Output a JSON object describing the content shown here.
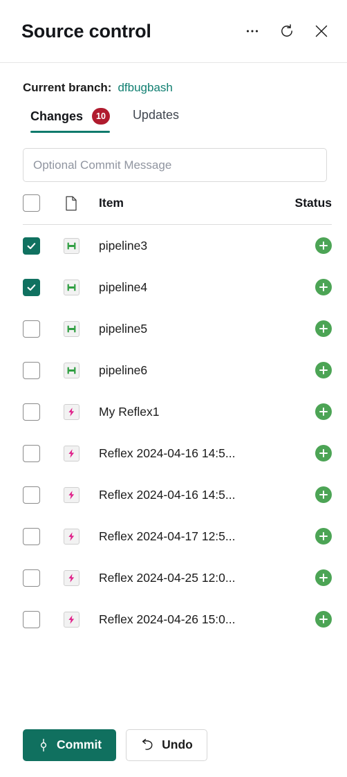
{
  "header": {
    "title": "Source control",
    "actions": [
      {
        "name": "more-options-icon",
        "label": "More options"
      },
      {
        "name": "refresh-icon",
        "label": "Refresh"
      },
      {
        "name": "close-icon",
        "label": "Close"
      }
    ]
  },
  "branch": {
    "label": "Current branch:",
    "name": "dfbugbash"
  },
  "tabs": [
    {
      "label": "Changes",
      "badge": "10",
      "active": true
    },
    {
      "label": "Updates",
      "badge": "",
      "active": false
    }
  ],
  "commit_message": {
    "value": "",
    "placeholder": "Optional Commit Message"
  },
  "table": {
    "headers": {
      "item": "Item",
      "status": "Status"
    },
    "select_all_checked": false,
    "rows": [
      {
        "name": "pipeline3",
        "checked": true,
        "icon": "pipeline-icon",
        "status": "add-icon"
      },
      {
        "name": "pipeline4",
        "checked": true,
        "icon": "pipeline-icon",
        "status": "add-icon"
      },
      {
        "name": "pipeline5",
        "checked": false,
        "icon": "pipeline-icon",
        "status": "add-icon"
      },
      {
        "name": "pipeline6",
        "checked": false,
        "icon": "pipeline-icon",
        "status": "add-icon"
      },
      {
        "name": "My Reflex1",
        "checked": false,
        "icon": "reflex-icon",
        "status": "add-icon"
      },
      {
        "name": "Reflex 2024-04-16 14:5...",
        "checked": false,
        "icon": "reflex-icon",
        "status": "add-icon"
      },
      {
        "name": "Reflex 2024-04-16 14:5...",
        "checked": false,
        "icon": "reflex-icon",
        "status": "add-icon"
      },
      {
        "name": "Reflex 2024-04-17 12:5...",
        "checked": false,
        "icon": "reflex-icon",
        "status": "add-icon"
      },
      {
        "name": "Reflex 2024-04-25 12:0...",
        "checked": false,
        "icon": "reflex-icon",
        "status": "add-icon"
      },
      {
        "name": "Reflex 2024-04-26 15:0...",
        "checked": false,
        "icon": "reflex-icon",
        "status": "add-icon"
      }
    ]
  },
  "footer": {
    "commit_label": "Commit",
    "undo_label": "Undo"
  },
  "colors": {
    "accent_teal": "#10705f",
    "branch_link": "#107f71",
    "badge_red": "#b01b2e",
    "status_green": "#4ca455",
    "pipeline_green": "#2f9e41",
    "reflex_pink": "#e0218a"
  }
}
